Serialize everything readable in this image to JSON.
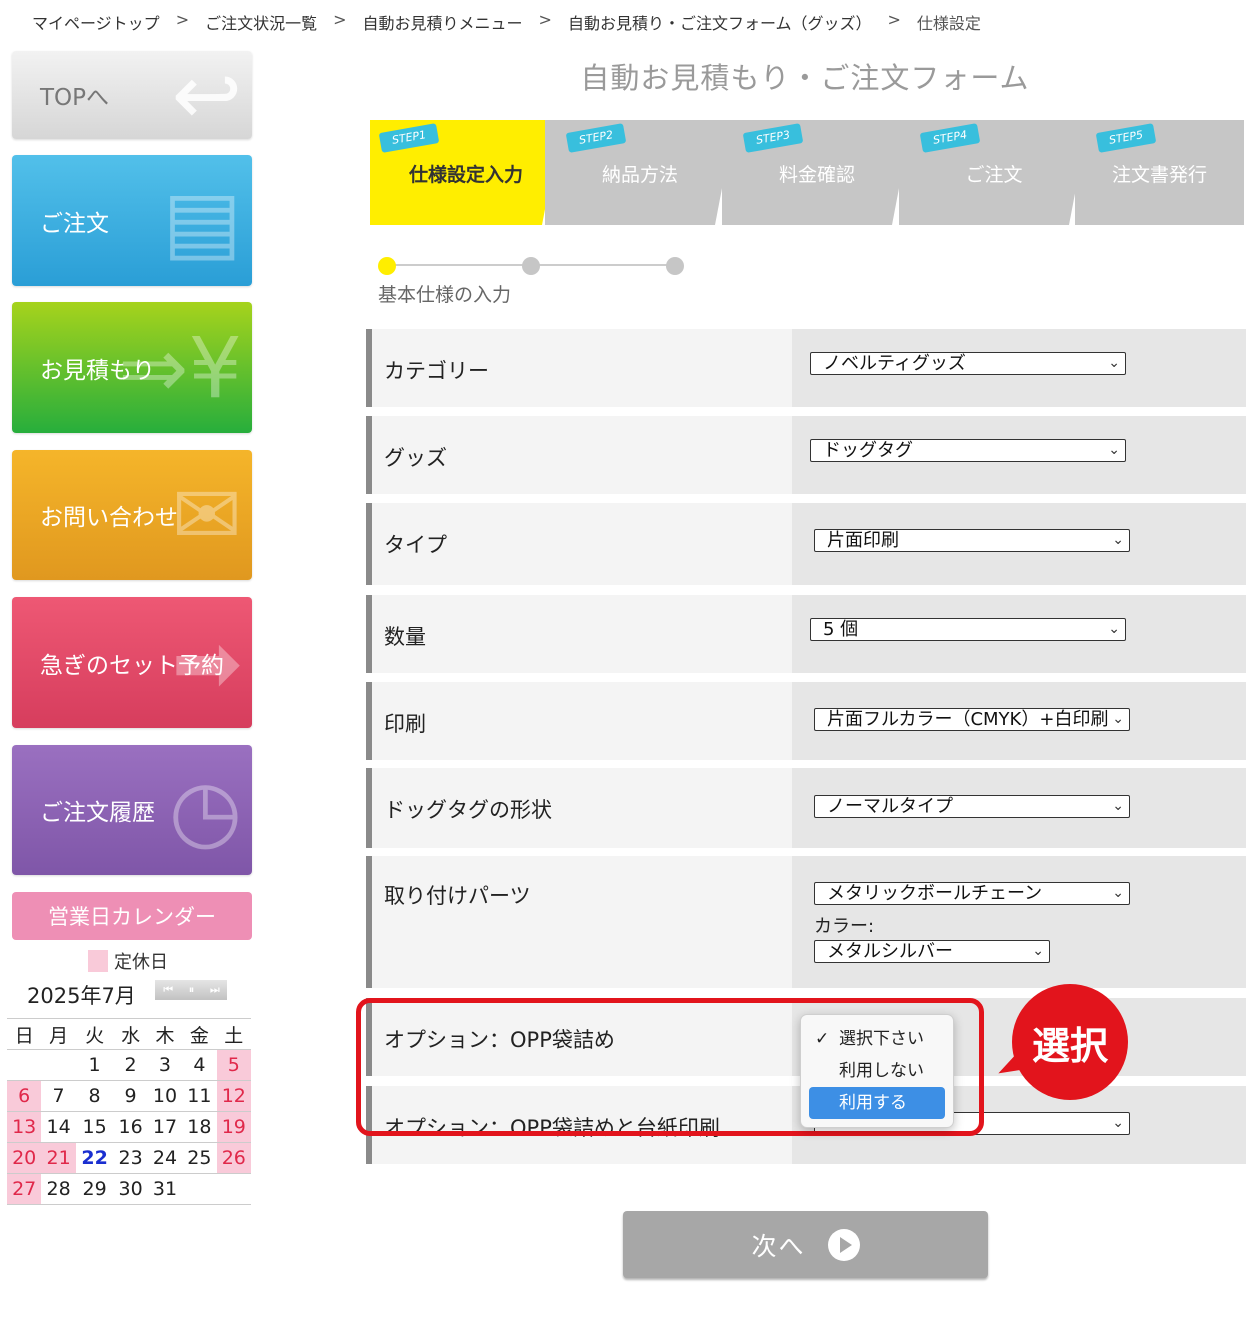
{
  "breadcrumb": {
    "items": [
      "マイページトップ",
      "ご注文状況一覧",
      "自動お見積りメニュー",
      "自動お見積り・ご注文フォーム（グッズ）"
    ],
    "current": "仕様設定",
    "separator": ">"
  },
  "sidebar": {
    "top": "TOPへ",
    "order": "ご注文",
    "quote": "お見積もり",
    "contact": "お問い合わせ",
    "rush": "急ぎのセット予約",
    "history": "ご注文履歴",
    "calendar_title": "営業日カレンダー",
    "legend_label": "定休日",
    "month": "2025年7月",
    "weekdays": [
      "日",
      "月",
      "火",
      "水",
      "木",
      "金",
      "土"
    ],
    "weeks": [
      [
        "",
        "",
        "1",
        "2",
        "3",
        "4",
        "5"
      ],
      [
        "6",
        "7",
        "8",
        "9",
        "10",
        "11",
        "12"
      ],
      [
        "13",
        "14",
        "15",
        "16",
        "17",
        "18",
        "19"
      ],
      [
        "20",
        "21",
        "22",
        "23",
        "24",
        "25",
        "26"
      ],
      [
        "27",
        "28",
        "29",
        "30",
        "31",
        "",
        ""
      ]
    ],
    "holidays": [
      "5",
      "6",
      "12",
      "13",
      "19",
      "20",
      "21",
      "26",
      "27"
    ],
    "today": "22"
  },
  "form_title": "自動お見積もり・ご注文フォーム",
  "steps": [
    {
      "badge": "STEP1",
      "name": "仕様設定入力"
    },
    {
      "badge": "STEP2",
      "name": "納品方法"
    },
    {
      "badge": "STEP3",
      "name": "料金確認"
    },
    {
      "badge": "STEP4",
      "name": "ご注文"
    },
    {
      "badge": "STEP5",
      "name": "注文書発行"
    }
  ],
  "sub_step_caption": "基本仕様の入力",
  "fields": {
    "category": {
      "label": "カテゴリー",
      "value": "ノベルティグッズ"
    },
    "goods": {
      "label": "グッズ",
      "value": "ドッグタグ"
    },
    "type": {
      "label": "タイプ",
      "value": "片面印刷"
    },
    "quantity": {
      "label": "数量",
      "value": "5 個"
    },
    "print": {
      "label": "印刷",
      "value": "片面フルカラー（CMYK）+白印刷"
    },
    "shape": {
      "label": "ドッグタグの形状",
      "value": "ノーマルタイプ"
    },
    "parts": {
      "label": "取り付けパーツ",
      "value": "メタリックボールチェーン",
      "color_label": "カラー:",
      "color_value": "メタルシルバー"
    },
    "opp": {
      "label": "オプション：OPP袋詰め"
    },
    "opp_print": {
      "label": "オプション：OPP袋詰めと台紙印刷"
    }
  },
  "dropdown": {
    "options": [
      "選択下さい",
      "利用しない",
      "利用する"
    ],
    "checked": "選択下さい",
    "highlighted": "利用する"
  },
  "annotation": "選択",
  "next_button": "次へ",
  "colors": {
    "active_step": "#ffee00",
    "highlight": "#e2141c",
    "holiday": "#f9cad9"
  }
}
